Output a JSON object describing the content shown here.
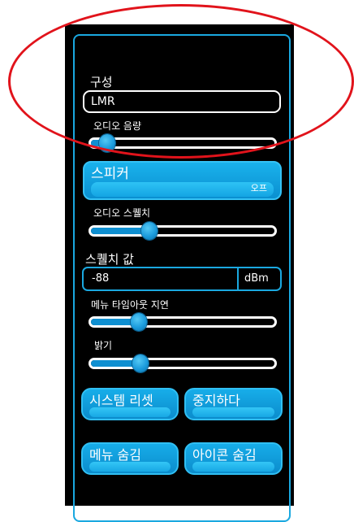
{
  "config": {
    "label": "구성",
    "value": "LMR"
  },
  "audio_volume": {
    "label": "오디오 음량",
    "level": 0.07
  },
  "speaker": {
    "label": "스피커",
    "state": "오프"
  },
  "audio_squelch": {
    "label": "오디오 스퀠치",
    "level": 0.31
  },
  "squelch_value": {
    "label": "스퀠치 값",
    "value": "-88",
    "unit": "dBm"
  },
  "menu_timeout": {
    "label": "메뉴 타임아웃 지연",
    "level": 0.25
  },
  "brightness": {
    "label": "밝기",
    "level": 0.26
  },
  "buttons": {
    "system_reset": "시스템 리셋",
    "stop": "중지하다",
    "hide_menu": "메뉴 숨김",
    "hide_icons": "아이콘 숨김"
  },
  "colors": {
    "accent": "#1aa8e0",
    "annotation": "#e1131b",
    "background": "#000000"
  }
}
